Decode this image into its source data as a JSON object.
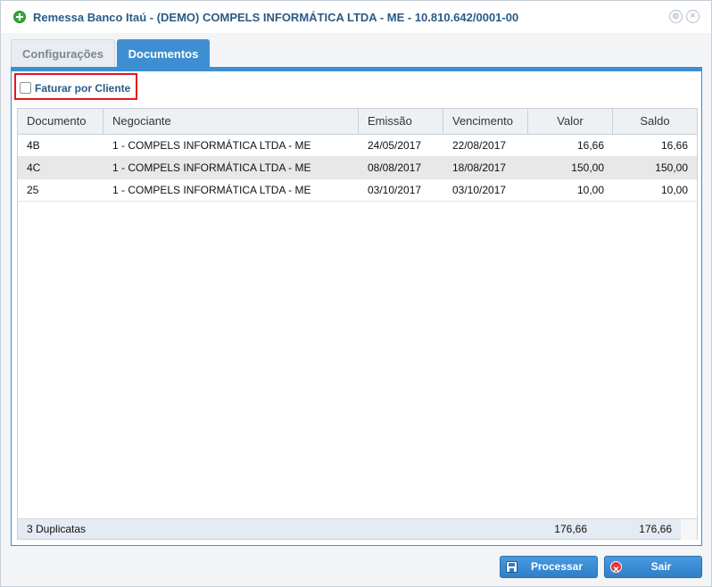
{
  "window": {
    "title": "Remessa Banco Itaú - (DEMO) COMPELS INFORMÁTICA LTDA - ME - 10.810.642/0001-00",
    "restore_glyph": "⊚",
    "close_glyph": "×"
  },
  "tabs": [
    {
      "label": "Configurações",
      "active": false
    },
    {
      "label": "Documentos",
      "active": true
    }
  ],
  "filter": {
    "label": "Faturar por Cliente",
    "checked": false
  },
  "grid": {
    "columns": [
      "Documento",
      "Negociante",
      "Emissão",
      "Vencimento",
      "Valor",
      "Saldo"
    ],
    "rows": [
      [
        "4B",
        "1 - COMPELS INFORMÁTICA LTDA - ME",
        "24/05/2017",
        "22/08/2017",
        "16,66",
        "16,66"
      ],
      [
        "4C",
        "1 - COMPELS INFORMÁTICA LTDA - ME",
        "08/08/2017",
        "18/08/2017",
        "150,00",
        "150,00"
      ],
      [
        "25",
        "1 - COMPELS INFORMÁTICA LTDA - ME",
        "03/10/2017",
        "03/10/2017",
        "10,00",
        "10,00"
      ]
    ],
    "footer": {
      "count_label": "3 Duplicatas",
      "total_valor": "176,66",
      "total_saldo": "176,66"
    }
  },
  "buttons": {
    "process_label": "Processar",
    "exit_label": "Sair"
  },
  "colors": {
    "accent": "#3d8fd1",
    "title": "#2a5b87",
    "highlight_border": "#e3171b"
  },
  "icons": {
    "title": "add-circle-icon",
    "process": "save-icon",
    "exit": "exit-icon"
  }
}
